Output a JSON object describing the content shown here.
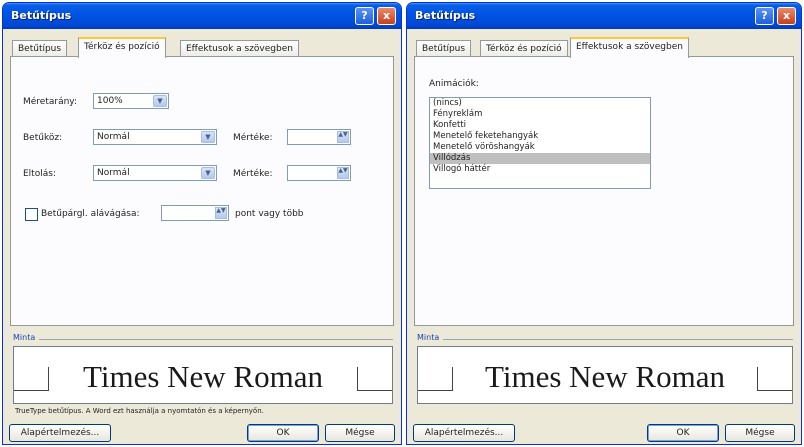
{
  "left_dialog": {
    "title": "Betűtípus",
    "tabs": [
      "Betűtípus",
      "Térköz és pozíció",
      "Effektusok a szövegben"
    ],
    "active_tab": 1,
    "scale_label": "Méretarány:",
    "scale_value": "100%",
    "spacing_label": "Betűköz:",
    "spacing_value": "Normál",
    "spacing_by_label": "Mértéke:",
    "position_label": "Eltolás:",
    "position_value": "Normál",
    "position_by_label": "Mértéke:",
    "kerning_label": "Betűpárgl. alávágása:",
    "kerning_suffix": "pont vagy több",
    "preview_label": "Minta",
    "preview_text": "Times New Roman",
    "footnote": "TrueType betűtípus. A Word ezt használja a nyomtatón és a képernyőn.",
    "default_button": "Alapértelmezés...",
    "ok_button": "OK",
    "cancel_button": "Mégse"
  },
  "right_dialog": {
    "title": "Betűtípus",
    "tabs": [
      "Betűtípus",
      "Térköz és pozíció",
      "Effektusok a szövegben"
    ],
    "active_tab": 2,
    "animation_label": "Animációk:",
    "animations": [
      "(nincs)",
      "Fényreklám",
      "Konfetti",
      "Menetelő feketehangyák",
      "Menetelő vöröshangyák",
      "Villódzás",
      "Villogó háttér"
    ],
    "selected_animation": 5,
    "preview_label": "Minta",
    "preview_text": "Times New Roman",
    "default_button": "Alapértelmezés...",
    "ok_button": "OK",
    "cancel_button": "Mégse"
  },
  "icons": {
    "help": "?",
    "close": "x",
    "dropdown": "▼",
    "spin": "▲▼"
  },
  "colors": {
    "titlebar": "#0054e3",
    "dialog_bg": "#ece9d8",
    "active_tab_accent": "#ffc83c",
    "selection": "#bfbfbf",
    "preview_legend": "#1a46b8"
  }
}
